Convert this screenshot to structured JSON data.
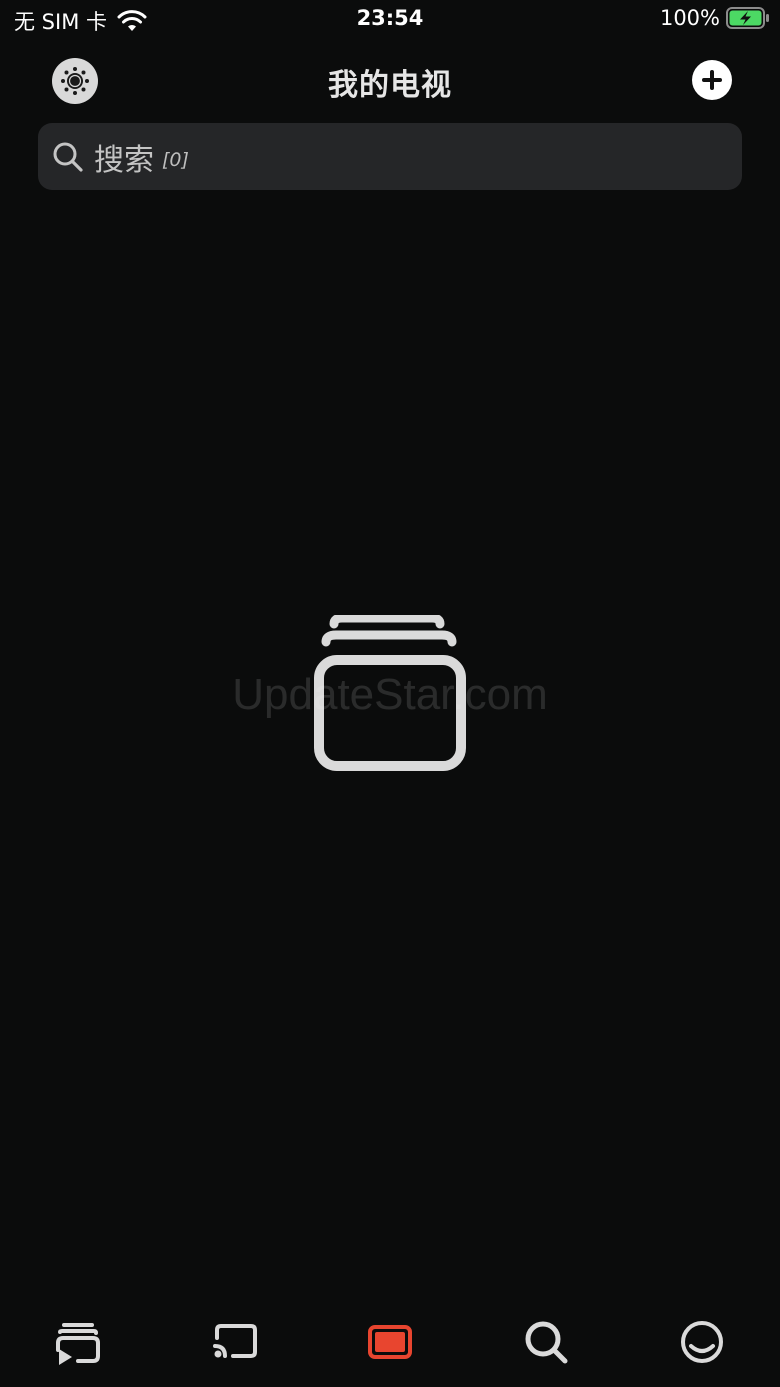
{
  "status_bar": {
    "carrier": "无 SIM 卡",
    "time": "23:54",
    "battery_percent": "100%"
  },
  "header": {
    "title": "我的电视",
    "settings_icon": "gear-icon",
    "add_icon": "plus-icon"
  },
  "search": {
    "placeholder": "搜索",
    "count": "[0]"
  },
  "empty_state": {
    "icon": "stacked-screens-icon"
  },
  "watermark": "UpdateStar.com",
  "tabs": [
    {
      "icon": "cast-play-icon",
      "active": false
    },
    {
      "icon": "screen-mirror-icon",
      "active": false
    },
    {
      "icon": "tv-screen-icon",
      "active": true
    },
    {
      "icon": "search-icon",
      "active": false
    },
    {
      "icon": "profile-icon",
      "active": false
    }
  ],
  "colors": {
    "background": "#0b0c0c",
    "accent": "#e8452f",
    "search_bg": "#252628",
    "icon": "#e0e0e0"
  }
}
